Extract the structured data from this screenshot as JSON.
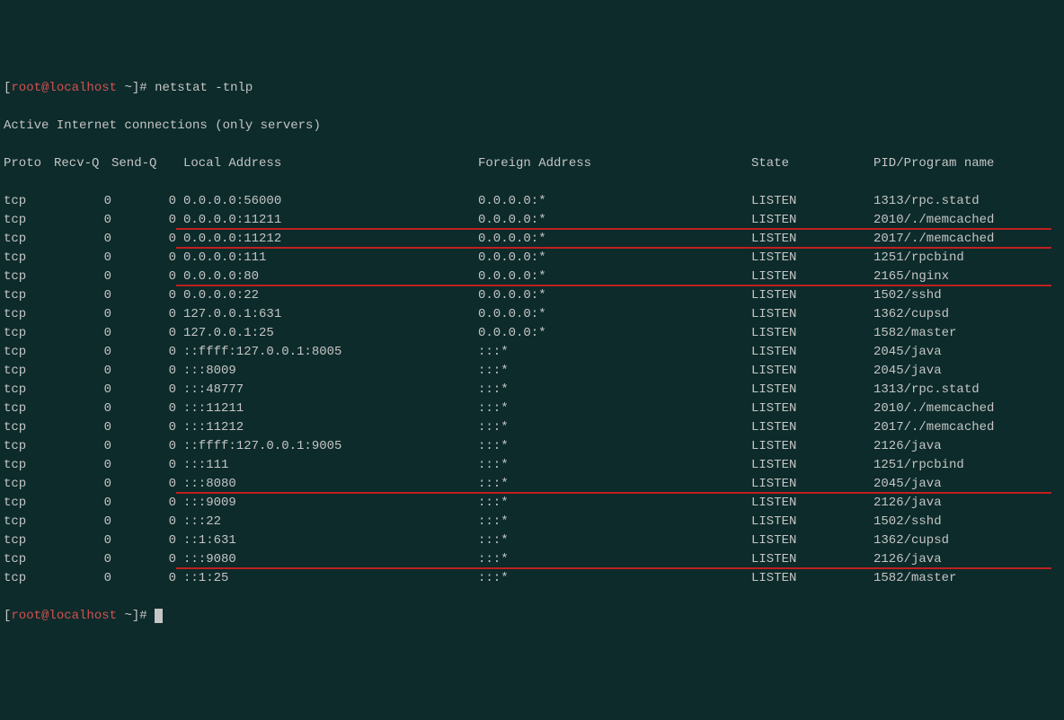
{
  "prompt": {
    "open_bracket": "[",
    "user": "root",
    "at": "@",
    "host": "localhost",
    "space": " ",
    "tilde": "~",
    "close_bracket": "]",
    "hash": "# "
  },
  "command": "netstat -tnlp",
  "title_line": "Active Internet connections (only servers)",
  "headers": {
    "proto": "Proto",
    "recvq": "Recv-Q",
    "sendq": "Send-Q",
    "local": "Local Address",
    "foreign": "Foreign Address",
    "state": "State",
    "pid": "PID/Program name"
  },
  "rows": [
    {
      "proto": "tcp",
      "recvq": "0",
      "sendq": "0",
      "local": "0.0.0.0:56000",
      "foreign": "0.0.0.0:*",
      "state": "LISTEN",
      "pid": "1313/rpc.statd",
      "hl": false
    },
    {
      "proto": "tcp",
      "recvq": "0",
      "sendq": "0",
      "local": "0.0.0.0:11211",
      "foreign": "0.0.0.0:*",
      "state": "LISTEN",
      "pid": "2010/./memcached",
      "hl": true
    },
    {
      "proto": "tcp",
      "recvq": "0",
      "sendq": "0",
      "local": "0.0.0.0:11212",
      "foreign": "0.0.0.0:*",
      "state": "LISTEN",
      "pid": "2017/./memcached",
      "hl": true
    },
    {
      "proto": "tcp",
      "recvq": "0",
      "sendq": "0",
      "local": "0.0.0.0:111",
      "foreign": "0.0.0.0:*",
      "state": "LISTEN",
      "pid": "1251/rpcbind",
      "hl": false
    },
    {
      "proto": "tcp",
      "recvq": "0",
      "sendq": "0",
      "local": "0.0.0.0:80",
      "foreign": "0.0.0.0:*",
      "state": "LISTEN",
      "pid": "2165/nginx",
      "hl": true
    },
    {
      "proto": "tcp",
      "recvq": "0",
      "sendq": "0",
      "local": "0.0.0.0:22",
      "foreign": "0.0.0.0:*",
      "state": "LISTEN",
      "pid": "1502/sshd",
      "hl": false
    },
    {
      "proto": "tcp",
      "recvq": "0",
      "sendq": "0",
      "local": "127.0.0.1:631",
      "foreign": "0.0.0.0:*",
      "state": "LISTEN",
      "pid": "1362/cupsd",
      "hl": false
    },
    {
      "proto": "tcp",
      "recvq": "0",
      "sendq": "0",
      "local": "127.0.0.1:25",
      "foreign": "0.0.0.0:*",
      "state": "LISTEN",
      "pid": "1582/master",
      "hl": false
    },
    {
      "proto": "tcp",
      "recvq": "0",
      "sendq": "0",
      "local": "::ffff:127.0.0.1:8005",
      "foreign": ":::*",
      "state": "LISTEN",
      "pid": "2045/java",
      "hl": false
    },
    {
      "proto": "tcp",
      "recvq": "0",
      "sendq": "0",
      "local": ":::8009",
      "foreign": ":::*",
      "state": "LISTEN",
      "pid": "2045/java",
      "hl": false
    },
    {
      "proto": "tcp",
      "recvq": "0",
      "sendq": "0",
      "local": ":::48777",
      "foreign": ":::*",
      "state": "LISTEN",
      "pid": "1313/rpc.statd",
      "hl": false
    },
    {
      "proto": "tcp",
      "recvq": "0",
      "sendq": "0",
      "local": ":::11211",
      "foreign": ":::*",
      "state": "LISTEN",
      "pid": "2010/./memcached",
      "hl": false
    },
    {
      "proto": "tcp",
      "recvq": "0",
      "sendq": "0",
      "local": ":::11212",
      "foreign": ":::*",
      "state": "LISTEN",
      "pid": "2017/./memcached",
      "hl": false
    },
    {
      "proto": "tcp",
      "recvq": "0",
      "sendq": "0",
      "local": "::ffff:127.0.0.1:9005",
      "foreign": ":::*",
      "state": "LISTEN",
      "pid": "2126/java",
      "hl": false
    },
    {
      "proto": "tcp",
      "recvq": "0",
      "sendq": "0",
      "local": ":::111",
      "foreign": ":::*",
      "state": "LISTEN",
      "pid": "1251/rpcbind",
      "hl": false
    },
    {
      "proto": "tcp",
      "recvq": "0",
      "sendq": "0",
      "local": ":::8080",
      "foreign": ":::*",
      "state": "LISTEN",
      "pid": "2045/java",
      "hl": true
    },
    {
      "proto": "tcp",
      "recvq": "0",
      "sendq": "0",
      "local": ":::9009",
      "foreign": ":::*",
      "state": "LISTEN",
      "pid": "2126/java",
      "hl": false
    },
    {
      "proto": "tcp",
      "recvq": "0",
      "sendq": "0",
      "local": ":::22",
      "foreign": ":::*",
      "state": "LISTEN",
      "pid": "1502/sshd",
      "hl": false
    },
    {
      "proto": "tcp",
      "recvq": "0",
      "sendq": "0",
      "local": "::1:631",
      "foreign": ":::*",
      "state": "LISTEN",
      "pid": "1362/cupsd",
      "hl": false
    },
    {
      "proto": "tcp",
      "recvq": "0",
      "sendq": "0",
      "local": ":::9080",
      "foreign": ":::*",
      "state": "LISTEN",
      "pid": "2126/java",
      "hl": true
    },
    {
      "proto": "tcp",
      "recvq": "0",
      "sendq": "0",
      "local": "::1:25",
      "foreign": ":::*",
      "state": "LISTEN",
      "pid": "1582/master",
      "hl": false
    }
  ]
}
